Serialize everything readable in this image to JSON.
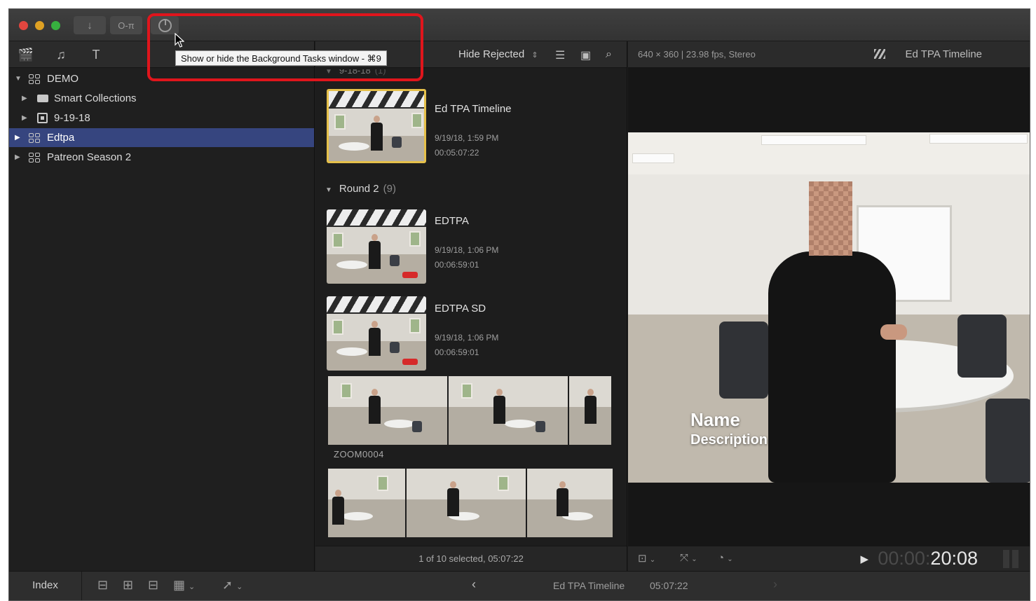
{
  "titlebar": {
    "import_icon": "download-arrow-icon",
    "keywords_icon": "key-icon",
    "background_tasks_icon": "background-tasks-dial-icon",
    "tooltip": "Show or hide the Background Tasks window - ⌘9"
  },
  "sidebar": {
    "toolbar_icons": [
      "libraries-clapper-icon",
      "photos-audio-icon",
      "titles-generators-icon"
    ],
    "items": [
      {
        "label": "DEMO",
        "expanded": true,
        "kind": "library"
      },
      {
        "label": "Smart Collections",
        "expanded": false,
        "kind": "folder"
      },
      {
        "label": "9-19-18",
        "expanded": false,
        "kind": "event"
      },
      {
        "label": "Edtpa",
        "expanded": false,
        "kind": "library",
        "selected": true
      },
      {
        "label": "Patreon Season 2",
        "expanded": false,
        "kind": "library"
      }
    ]
  },
  "browser": {
    "filter_label": "Hide Rejected",
    "filter_chevron": "⌃⌄",
    "partial_group_header": "9-18-18",
    "partial_group_count": "(1)",
    "clip1": {
      "name": "Ed TPA Timeline",
      "date": "9/19/18, 1:59 PM",
      "duration": "00:05:07:22"
    },
    "group": {
      "name": "Round 2",
      "count": "(9)"
    },
    "clip2": {
      "name": "EDTPA",
      "date": "9/19/18, 1:06 PM",
      "duration": "00:06:59:01"
    },
    "clip3": {
      "name": "EDTPA SD",
      "date": "9/19/18, 1:06 PM",
      "duration": "00:06:59:01"
    },
    "strip_label": "ZOOM0004",
    "status": "1 of 10 selected, 05:07:22"
  },
  "viewer": {
    "format": "640 × 360 | 23.98 fps, Stereo",
    "title": "Ed TPA Timeline",
    "lower_third_name": "Name",
    "lower_third_desc": "Description",
    "timecode_dim": "00:00:",
    "timecode_bright": "20:08"
  },
  "bottom": {
    "index_label": "Index",
    "timeline_name": "Ed TPA Timeline",
    "timeline_duration": "05:07:22"
  },
  "colors": {
    "selection": "#36457f",
    "accent_blue": "#4f7ff0",
    "clip_selected_border": "#e5c04a",
    "highlight_red": "#e0151c"
  }
}
